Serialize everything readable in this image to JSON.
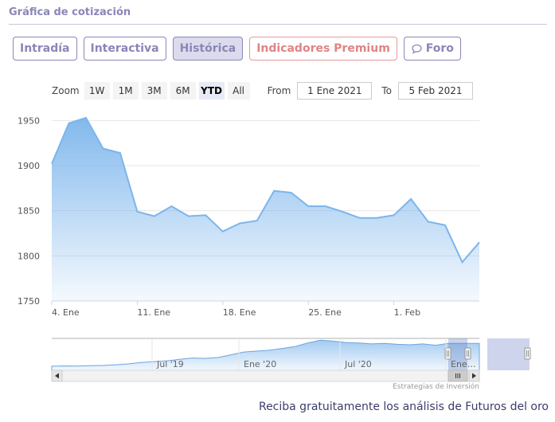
{
  "header": {
    "title": "Gráfica de cotización"
  },
  "tabs": [
    {
      "label": "Intradía",
      "active": false
    },
    {
      "label": "Interactiva",
      "active": false
    },
    {
      "label": "Histórica",
      "active": true
    },
    {
      "label": "Indicadores Premium",
      "active": false
    },
    {
      "label": "Foro",
      "active": false,
      "icon": "speech-bubble-icon"
    }
  ],
  "range_selector": {
    "zoom_label": "Zoom",
    "buttons": [
      "1W",
      "1M",
      "3M",
      "6M",
      "YTD",
      "All"
    ],
    "active": "YTD",
    "from_label": "From",
    "from_value": "1 Ene 2021",
    "to_label": "To",
    "to_value": "5 Feb 2021"
  },
  "colors": {
    "accent": "#8a86b8",
    "premium": "#e08484",
    "series_line": "#7cb5ec",
    "footer": "#3c3c6e"
  },
  "chart_data": {
    "type": "area",
    "ylim": [
      1750,
      1960
    ],
    "yticks": [
      1750,
      1800,
      1850,
      1900,
      1950
    ],
    "x": [
      "2021-01-04",
      "2021-01-05",
      "2021-01-06",
      "2021-01-07",
      "2021-01-08",
      "2021-01-11",
      "2021-01-12",
      "2021-01-13",
      "2021-01-14",
      "2021-01-15",
      "2021-01-18",
      "2021-01-19",
      "2021-01-20",
      "2021-01-21",
      "2021-01-22",
      "2021-01-25",
      "2021-01-26",
      "2021-01-27",
      "2021-01-28",
      "2021-01-29",
      "2021-02-01",
      "2021-02-02",
      "2021-02-03",
      "2021-02-04",
      "2021-02-05"
    ],
    "values": [
      1902,
      1947,
      1953,
      1919,
      1914,
      1849,
      1844,
      1855,
      1844,
      1845,
      1827,
      1836,
      1839,
      1872,
      1870,
      1855,
      1855,
      1849,
      1842,
      1842,
      1845,
      1863,
      1838,
      1834,
      1793,
      1815
    ],
    "xticks": [
      {
        "date": "2021-01-04",
        "label": "4. Ene"
      },
      {
        "date": "2021-01-11",
        "label": "11. Ene"
      },
      {
        "date": "2021-01-18",
        "label": "18. Ene"
      },
      {
        "date": "2021-01-25",
        "label": "25. Ene"
      },
      {
        "date": "2021-02-01",
        "label": "1. Feb"
      }
    ],
    "navigator": {
      "labels": [
        "Jul '19",
        "Ene '20",
        "Jul '20",
        "Ene…"
      ],
      "values": [
        1390,
        1395,
        1393,
        1400,
        1405,
        1420,
        1440,
        1470,
        1490,
        1505,
        1540,
        1570,
        1560,
        1580,
        1640,
        1700,
        1720,
        1740,
        1780,
        1820,
        1900,
        1960,
        1940,
        1910,
        1900,
        1880,
        1890,
        1870,
        1860,
        1880,
        1850,
        1890
      ]
    }
  },
  "credit": "Estrategias de Inversión",
  "footer": {
    "text": "Reciba gratuitamente los análisis de Futuros del oro"
  }
}
